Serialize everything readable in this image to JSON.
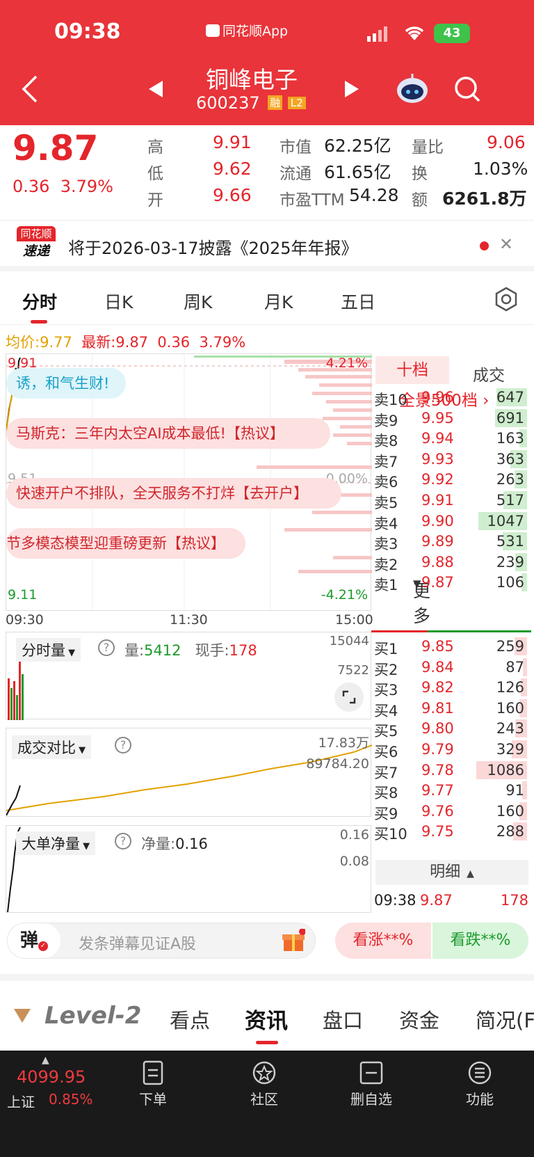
{
  "status": {
    "time": "09:38",
    "app_label": "同花顺App",
    "battery": "43"
  },
  "stock": {
    "name": "铜峰电子",
    "code": "600237",
    "badge_rong": "融",
    "badge_l2": "L2"
  },
  "quote": {
    "price": "9.87",
    "change": "0.36",
    "change_pct": "3.79%",
    "high_label": "高",
    "high": "9.91",
    "low_label": "低",
    "low": "9.62",
    "open_label": "开",
    "open": "9.66",
    "mktcap_label": "市值",
    "mktcap": "62.25亿",
    "float_label": "流通",
    "float": "61.65亿",
    "pe_label": "市盈TTM",
    "pe": "54.28",
    "vr_label": "量比",
    "vr": "9.06",
    "turnover_label": "换",
    "turnover": "1.03%",
    "amount_label": "额",
    "amount": "6261.8万"
  },
  "news": {
    "logo_top": "同花顺",
    "logo_bottom": "速递",
    "text": "将于2026-03-17披露《2025年年报》"
  },
  "tabs": [
    "分时",
    "日K",
    "周K",
    "月K",
    "五日",
    "更多"
  ],
  "chart_info": {
    "avg_label": "均价:",
    "avg": "9.77",
    "last_label": "最新:",
    "last": "9.87",
    "chg": "0.36",
    "chg_pct": "3.79%"
  },
  "axis": {
    "top_price": "9.91",
    "mid_price": "9.51",
    "bottom_price": "9.11",
    "top_pct": "4.21%",
    "mid_pct": "0.00%",
    "bottom_pct": "-4.21%",
    "t_start": "09:30",
    "t_mid": "11:30",
    "t_end": "15:00"
  },
  "danmaku": [
    "诱，和气生财!",
    "马斯克：三年内太空AI成本最低!【热议】",
    "快速开户不排队，全天服务不打烊【去开户】",
    "节多模态模型迎重磅更新【热议】"
  ],
  "volume_panel": {
    "selector": "分时量",
    "vol_label": "量:",
    "vol": "5412",
    "hand_label": "现手:",
    "hand": "178",
    "y_top": "15044",
    "y_mid": "7522"
  },
  "compare_panel": {
    "selector": "成交对比",
    "y_top": "17.83万",
    "y_mid": "89784.20"
  },
  "bigorder_panel": {
    "selector": "大单净量",
    "net_label": "净量:",
    "net": "0.16",
    "y_top": "0.16",
    "y_mid": "0.08"
  },
  "orderbook": {
    "tab_ten": "十档",
    "tab_trade": "成交",
    "full_depth": "全景500档",
    "asks": [
      {
        "label": "卖10",
        "price": "9.96",
        "vol": "647",
        "frac": 0.4
      },
      {
        "label": "卖9",
        "price": "9.95",
        "vol": "691",
        "frac": 0.42
      },
      {
        "label": "卖8",
        "price": "9.94",
        "vol": "163",
        "frac": 0.1
      },
      {
        "label": "卖7",
        "price": "9.93",
        "vol": "363",
        "frac": 0.22
      },
      {
        "label": "卖6",
        "price": "9.92",
        "vol": "263",
        "frac": 0.16
      },
      {
        "label": "卖5",
        "price": "9.91",
        "vol": "517",
        "frac": 0.31
      },
      {
        "label": "卖4",
        "price": "9.90",
        "vol": "1047",
        "frac": 0.64
      },
      {
        "label": "卖3",
        "price": "9.89",
        "vol": "531",
        "frac": 0.32
      },
      {
        "label": "卖2",
        "price": "9.88",
        "vol": "239",
        "frac": 0.15
      },
      {
        "label": "卖1",
        "price": "9.87",
        "vol": "106",
        "frac": 0.07
      }
    ],
    "bids": [
      {
        "label": "买1",
        "price": "9.85",
        "vol": "259",
        "frac": 0.16
      },
      {
        "label": "买2",
        "price": "9.84",
        "vol": "87",
        "frac": 0.05
      },
      {
        "label": "买3",
        "price": "9.82",
        "vol": "126",
        "frac": 0.08
      },
      {
        "label": "买4",
        "price": "9.81",
        "vol": "160",
        "frac": 0.1
      },
      {
        "label": "买5",
        "price": "9.80",
        "vol": "243",
        "frac": 0.15
      },
      {
        "label": "买6",
        "price": "9.79",
        "vol": "329",
        "frac": 0.2
      },
      {
        "label": "买7",
        "price": "9.78",
        "vol": "1086",
        "frac": 0.66
      },
      {
        "label": "买8",
        "price": "9.77",
        "vol": "91",
        "frac": 0.06
      },
      {
        "label": "买9",
        "price": "9.76",
        "vol": "160",
        "frac": 0.1
      },
      {
        "label": "买10",
        "price": "9.75",
        "vol": "288",
        "frac": 0.18
      }
    ],
    "detail_label": "明细",
    "last_trade": {
      "time": "09:38",
      "price": "9.87",
      "vol": "178"
    }
  },
  "comment": {
    "barrage_btn": "弹",
    "placeholder": "发条弹幕见证A股",
    "bull": "看涨**%",
    "bear": "看跌**%"
  },
  "section_tabs": [
    "Level-2",
    "看点",
    "资讯",
    "盘口",
    "资金",
    "简况(F"
  ],
  "bottom": {
    "index_value": "4099.95",
    "index_name": "上证",
    "index_pct": "0.85%",
    "order": "下单",
    "community": "社区",
    "remove_fav": "删自选",
    "function": "功能"
  },
  "colors": {
    "header": "#e8343a",
    "up": "#e4252b",
    "down": "#1a9a2a",
    "bottom_bar": "#1a1a1a"
  }
}
